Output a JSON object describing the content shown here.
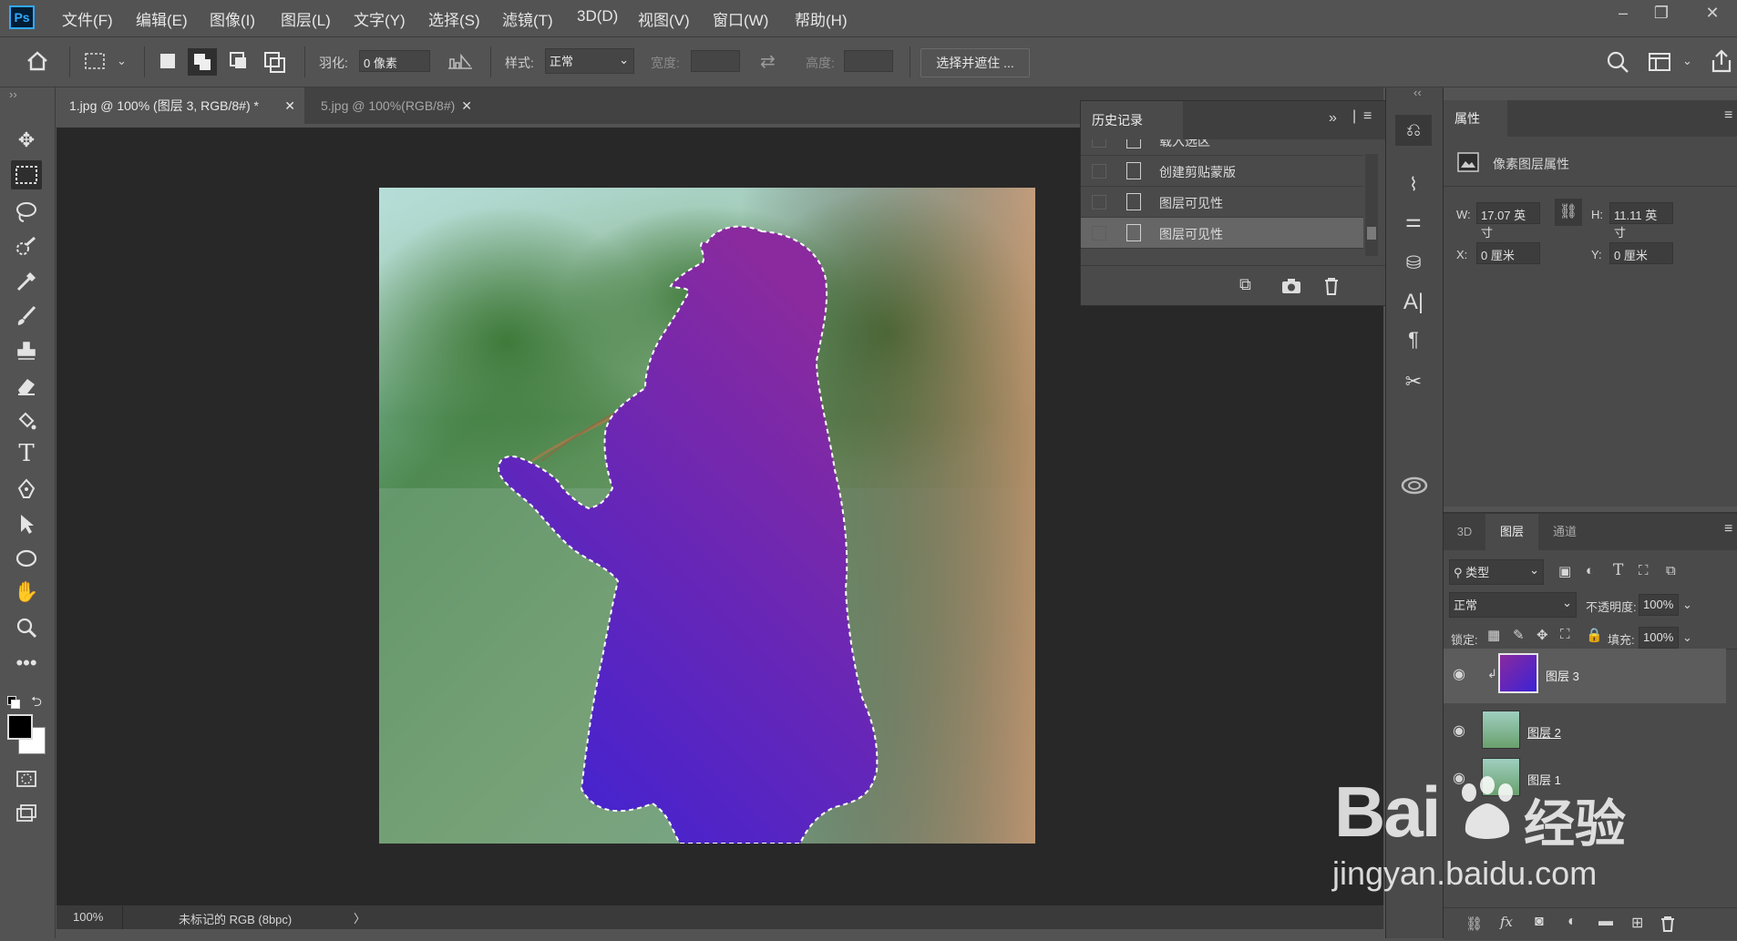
{
  "app": {
    "logo": "Ps"
  },
  "menu": [
    "文件(F)",
    "编辑(E)",
    "图像(I)",
    "图层(L)",
    "文字(Y)",
    "选择(S)",
    "滤镜(T)",
    "3D(D)",
    "视图(V)",
    "窗口(W)",
    "帮助(H)"
  ],
  "window_controls": {
    "minimize": "–",
    "restore": "❐",
    "close": "✕"
  },
  "options": {
    "feather_label": "羽化:",
    "feather_value": "0 像素",
    "style_label": "样式:",
    "style_value": "正常",
    "width_label": "宽度:",
    "height_label": "高度:",
    "select_mask_button": "选择并遮住 ..."
  },
  "tabs": [
    {
      "label": "1.jpg @ 100% (图层 3, RGB/8#) *",
      "close": "✕",
      "active": true
    },
    {
      "label": "5.jpg @ 100%(RGB/8#)",
      "close": "✕",
      "active": false
    }
  ],
  "status": {
    "zoom": "100%",
    "profile": "未标记的 RGB (8bpc)",
    "arrow": "〉"
  },
  "history": {
    "title": "历史记录",
    "items": [
      "载入选区",
      "创建剪贴蒙版",
      "图层可见性",
      "图层可见性"
    ]
  },
  "properties": {
    "title": "属性",
    "subtitle": "像素图层属性",
    "w_label": "W:",
    "w_value": "17.07 英寸",
    "h_label": "H:",
    "h_value": "11.11 英寸",
    "x_label": "X:",
    "x_value": "0 厘米",
    "y_label": "Y:",
    "y_value": "0 厘米"
  },
  "layers_panel": {
    "tabs": [
      "3D",
      "图层",
      "通道"
    ],
    "active_tab": "图层",
    "filter_label": "类型",
    "blend_mode": "正常",
    "opacity_label": "不透明度:",
    "opacity_value": "100%",
    "lock_label": "锁定:",
    "fill_label": "填充:",
    "fill_value": "100%",
    "layers": [
      {
        "name": "图层 3",
        "selected": true
      },
      {
        "name": "图层 2",
        "selected": false
      },
      {
        "name": "图层 1",
        "selected": false
      }
    ]
  },
  "watermark": {
    "brand": "Bai",
    "brand2": "经验",
    "url": "jingyan.baidu.com"
  },
  "colors": {
    "gradient_start": "#3b22d6",
    "gradient_end": "#8a2a9e",
    "accent": "#31a8ff"
  }
}
